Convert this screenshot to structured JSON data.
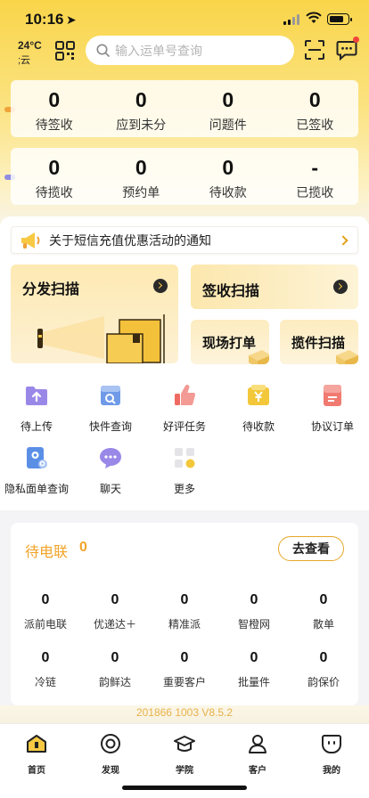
{
  "status_bar": {
    "time": "10:16",
    "location_arrow": "➤"
  },
  "header": {
    "weather_temp": "24°C",
    "weather_desc": ";云",
    "search_placeholder": "输入运单号查询"
  },
  "stats_row1": [
    {
      "value": "0",
      "label": "待签收"
    },
    {
      "value": "0",
      "label": "应到未分"
    },
    {
      "value": "0",
      "label": "问题件"
    },
    {
      "value": "0",
      "label": "已签收"
    }
  ],
  "stats_row2": [
    {
      "value": "0",
      "label": "待揽收"
    },
    {
      "value": "0",
      "label": "预约单"
    },
    {
      "value": "0",
      "label": "待收款"
    },
    {
      "value": "-",
      "label": "已揽收"
    }
  ],
  "notice": {
    "text": "关于短信充值优惠活动的通知"
  },
  "actions": {
    "dispatch_scan": "分发扫描",
    "sign_scan": "签收扫描",
    "onsite_print": "现场打单",
    "pickup_scan": "揽件扫描"
  },
  "grid": [
    {
      "label": "待上传",
      "icon": "upload-folder-icon"
    },
    {
      "label": "快件查询",
      "icon": "parcel-search-icon"
    },
    {
      "label": "好评任务",
      "icon": "thumbs-up-icon"
    },
    {
      "label": "待收款",
      "icon": "yen-wallet-icon"
    },
    {
      "label": "协议订单",
      "icon": "agreement-order-icon"
    },
    {
      "label": "隐私面单查询",
      "icon": "privacy-waybill-icon"
    },
    {
      "label": "聊天",
      "icon": "chat-bubble-icon"
    },
    {
      "label": "更多",
      "icon": "more-grid-icon"
    }
  ],
  "pending_contact": {
    "title": "待电联",
    "count": "0",
    "button": "去查看",
    "cells": [
      {
        "value": "0",
        "label": "派前电联"
      },
      {
        "value": "0",
        "label": "优递达＋"
      },
      {
        "value": "0",
        "label": "精准派"
      },
      {
        "value": "0",
        "label": "智橙网"
      },
      {
        "value": "0",
        "label": "散单"
      },
      {
        "value": "0",
        "label": "冷链"
      },
      {
        "value": "0",
        "label": "韵鲜达"
      },
      {
        "value": "0",
        "label": "重要客户"
      },
      {
        "value": "0",
        "label": "批量件"
      },
      {
        "value": "0",
        "label": "韵保价"
      }
    ]
  },
  "version": "201866  1003  V8.5.2",
  "tabbar": [
    {
      "label": "首页",
      "icon": "home-icon"
    },
    {
      "label": "发现",
      "icon": "discover-icon"
    },
    {
      "label": "学院",
      "icon": "academy-cap-icon"
    },
    {
      "label": "客户",
      "icon": "customer-icon"
    },
    {
      "label": "我的",
      "icon": "profile-face-icon"
    }
  ],
  "colors": {
    "accent": "#f7c943",
    "orange_text": "#f2a42a",
    "badge_red": "#f0433a"
  }
}
